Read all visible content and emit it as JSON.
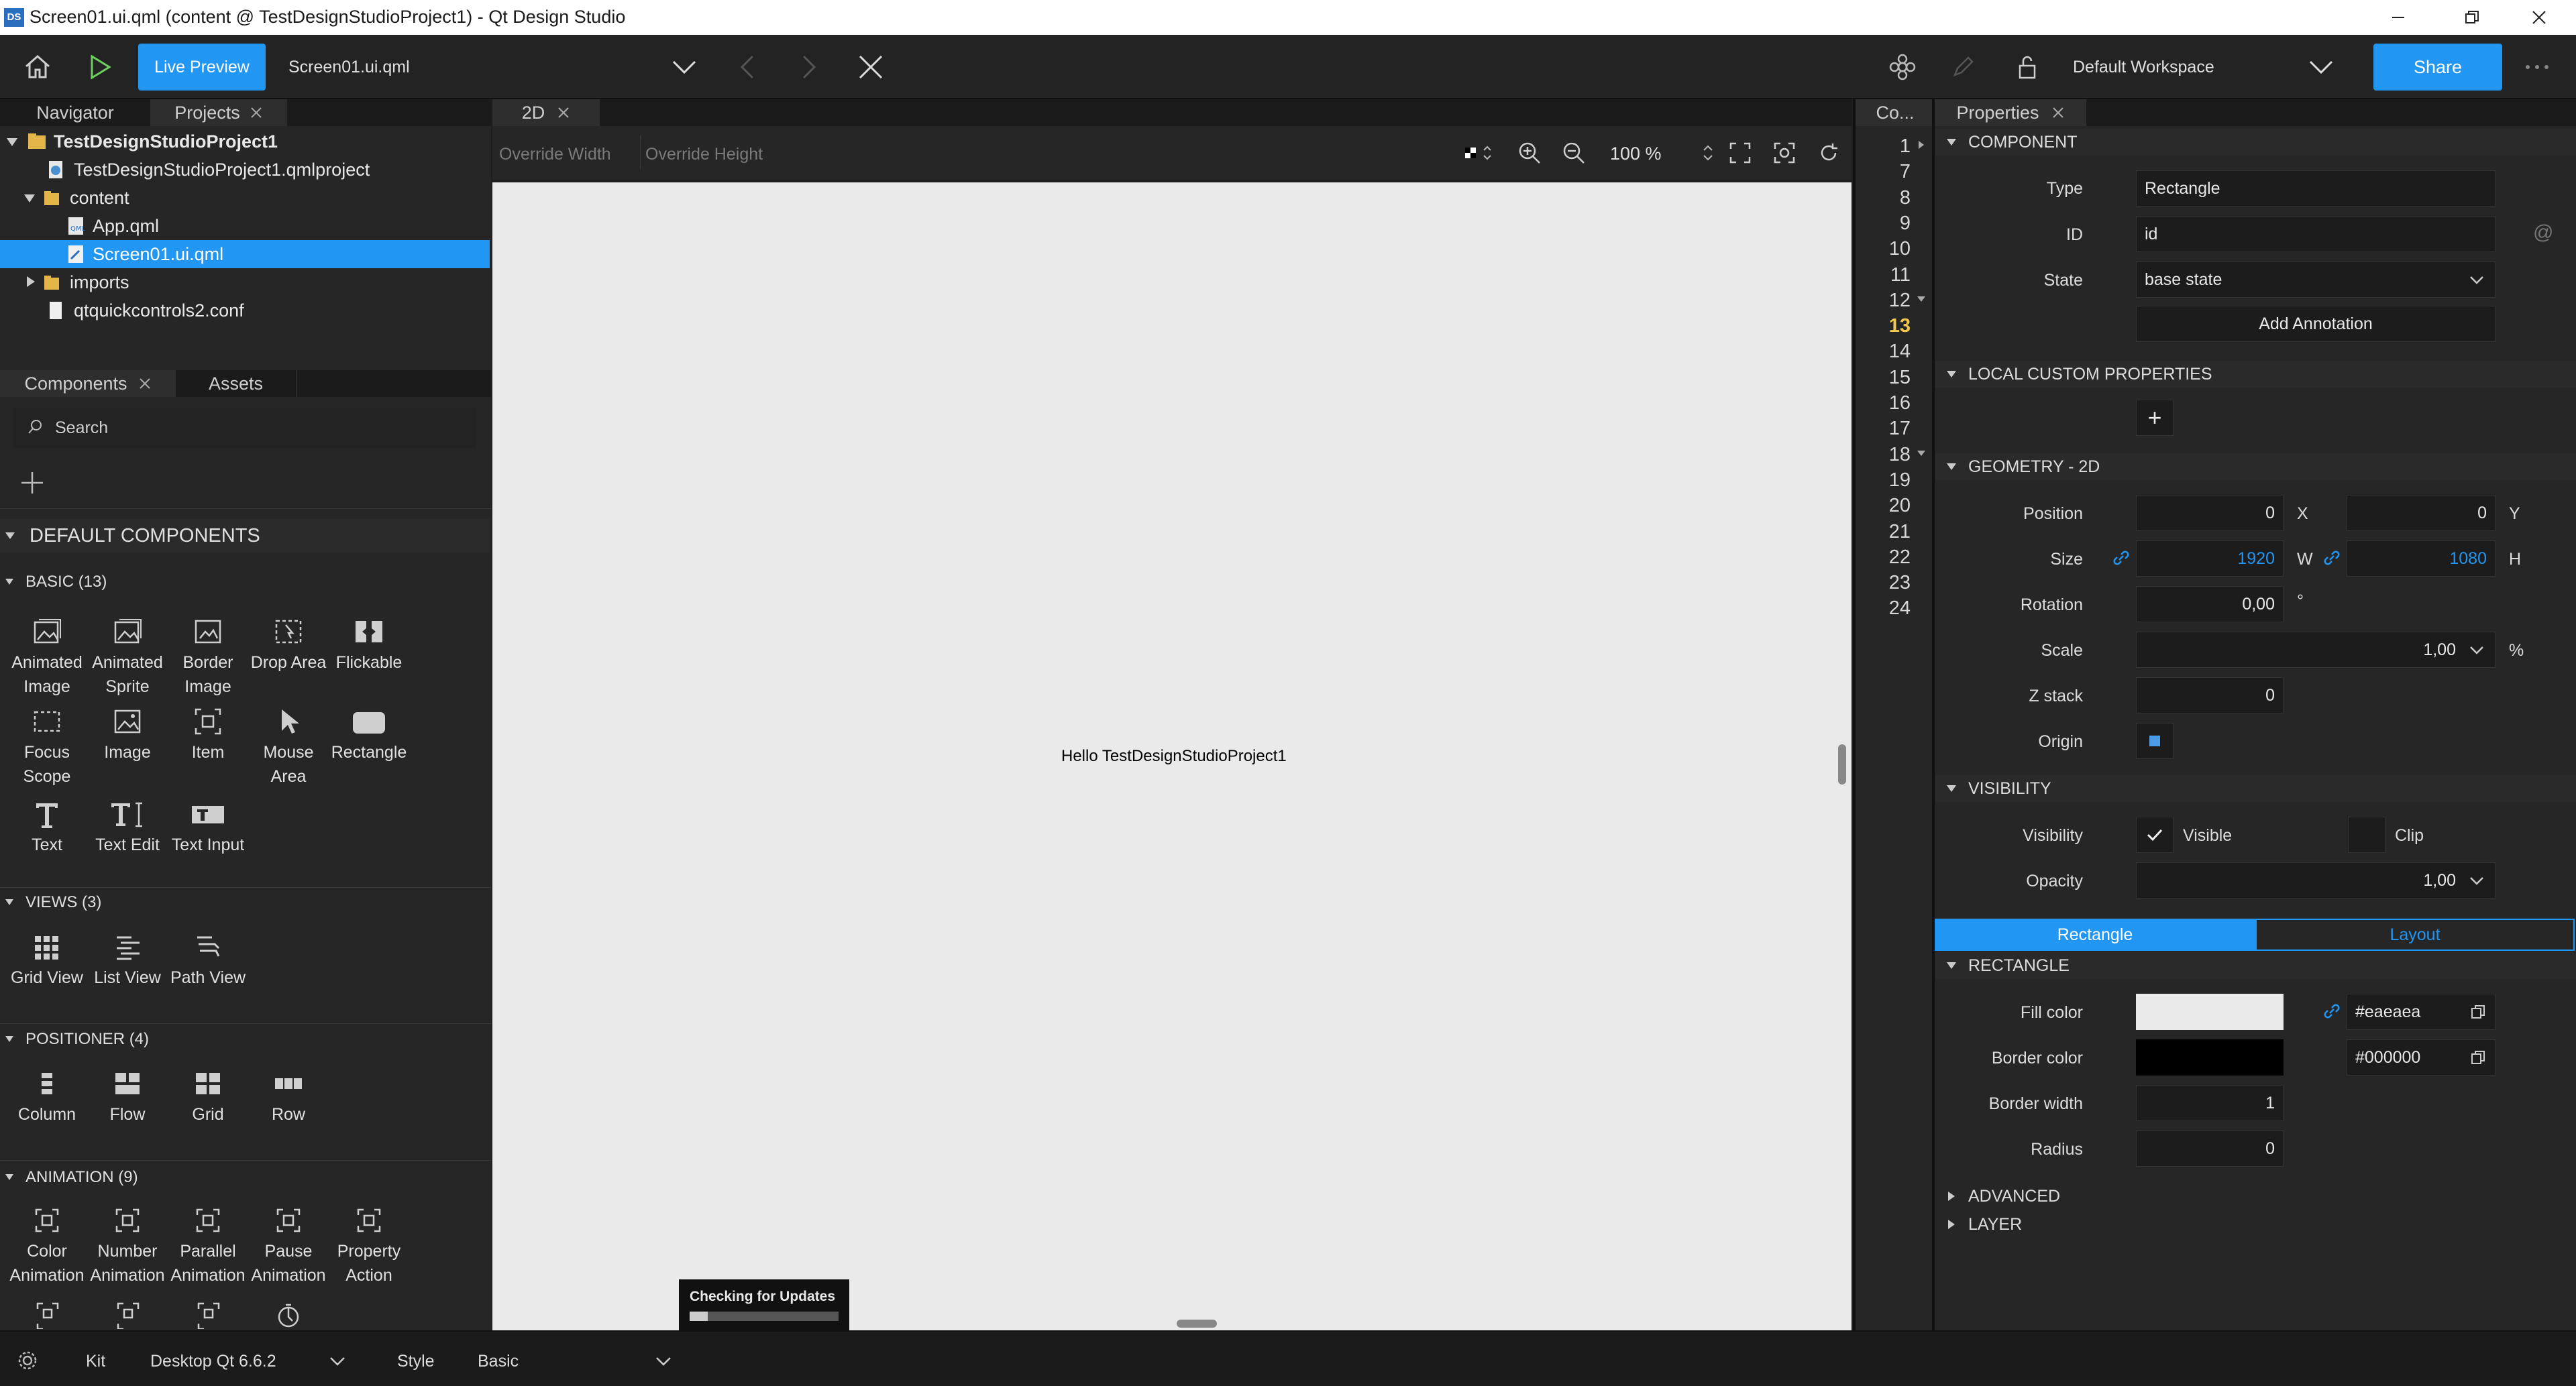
{
  "window": {
    "title": "Screen01.ui.qml (content @ TestDesignStudioProject1) - Qt Design Studio",
    "app_badge": "DS"
  },
  "toolbar": {
    "live_preview": "Live Preview",
    "current_file": "Screen01.ui.qml",
    "workspace": "Default Workspace",
    "share": "Share"
  },
  "left_top_tabs": {
    "navigator": "Navigator",
    "projects": "Projects"
  },
  "project_tree": [
    {
      "label": "TestDesignStudioProject1",
      "bold": true
    },
    {
      "label": "TestDesignStudioProject1.qmlproject"
    },
    {
      "label": "content"
    },
    {
      "label": "App.qml"
    },
    {
      "label": "Screen01.ui.qml",
      "selected": true
    },
    {
      "label": "imports"
    },
    {
      "label": "qtquickcontrols2.conf"
    }
  ],
  "left_bottom_tabs": {
    "components": "Components",
    "assets": "Assets"
  },
  "search": {
    "placeholder": "Search"
  },
  "library": {
    "default_header": "DEFAULT COMPONENTS",
    "basic": {
      "header": "BASIC (13)",
      "items": [
        "Animated Image",
        "Animated Sprite",
        "Border Image",
        "Drop Area",
        "Flickable",
        "Focus Scope",
        "Image",
        "Item",
        "Mouse Area",
        "Rectangle",
        "Text",
        "Text Edit",
        "Text Input"
      ]
    },
    "views": {
      "header": "VIEWS (3)",
      "items": [
        "Grid View",
        "List View",
        "Path View"
      ]
    },
    "positioner": {
      "header": "POSITIONER (4)",
      "items": [
        "Column",
        "Flow",
        "Grid",
        "Row"
      ]
    },
    "animation": {
      "header": "ANIMATION (9)",
      "items": [
        "Color Animation",
        "Number Animation",
        "Parallel Animation",
        "Pause Animation",
        "Property Action"
      ]
    }
  },
  "editor": {
    "tab": "2D",
    "override_width": "Override Width",
    "override_height": "Override Height",
    "zoom": "100 %",
    "canvas_text": "Hello TestDesignStudioProject1",
    "update_toast": "Checking for Updates",
    "update_progress": 0.12
  },
  "code_tab": "Co...",
  "line_numbers": [
    "1",
    "7",
    "8",
    "9",
    "10",
    "11",
    "12",
    "13",
    "14",
    "15",
    "16",
    "17",
    "18",
    "19",
    "20",
    "21",
    "22",
    "23",
    "24"
  ],
  "current_line": "13",
  "properties": {
    "tab": "Properties",
    "component": {
      "header": "COMPONENT",
      "type_label": "Type",
      "type_value": "Rectangle",
      "id_label": "ID",
      "id_value": "id",
      "state_label": "State",
      "state_value": "base state",
      "add_annotation": "Add Annotation"
    },
    "local_custom": {
      "header": "LOCAL CUSTOM PROPERTIES",
      "add": "+"
    },
    "geometry": {
      "header": "GEOMETRY - 2D",
      "position_label": "Position",
      "x": "0",
      "x_unit": "X",
      "y": "0",
      "y_unit": "Y",
      "size_label": "Size",
      "w": "1920",
      "w_unit": "W",
      "h": "1080",
      "h_unit": "H",
      "rotation_label": "Rotation",
      "rotation": "0,00",
      "rotation_unit": "°",
      "scale_label": "Scale",
      "scale": "1,00",
      "scale_unit": "%",
      "z_label": "Z stack",
      "z": "0",
      "origin_label": "Origin"
    },
    "visibility": {
      "header": "VISIBILITY",
      "visibility_label": "Visibility",
      "visible": "Visible",
      "clip": "Clip",
      "opacity_label": "Opacity",
      "opacity": "1,00"
    },
    "subtabs": {
      "rectangle": "Rectangle",
      "layout": "Layout"
    },
    "rectangle": {
      "header": "RECTANGLE",
      "fill_label": "Fill color",
      "fill_hex": "#eaeaea",
      "border_label": "Border color",
      "border_hex": "#000000",
      "border_width_label": "Border width",
      "border_width": "1",
      "radius_label": "Radius",
      "radius": "0"
    },
    "advanced": "ADVANCED",
    "layer": "LAYER"
  },
  "statusbar": {
    "kit_label": "Kit",
    "kit_value": "Desktop Qt 6.6.2",
    "style_label": "Style",
    "style_value": "Basic"
  },
  "colors": {
    "accent": "#2196f3",
    "canvas": "#eaeaea",
    "selection": "#2196f3"
  }
}
